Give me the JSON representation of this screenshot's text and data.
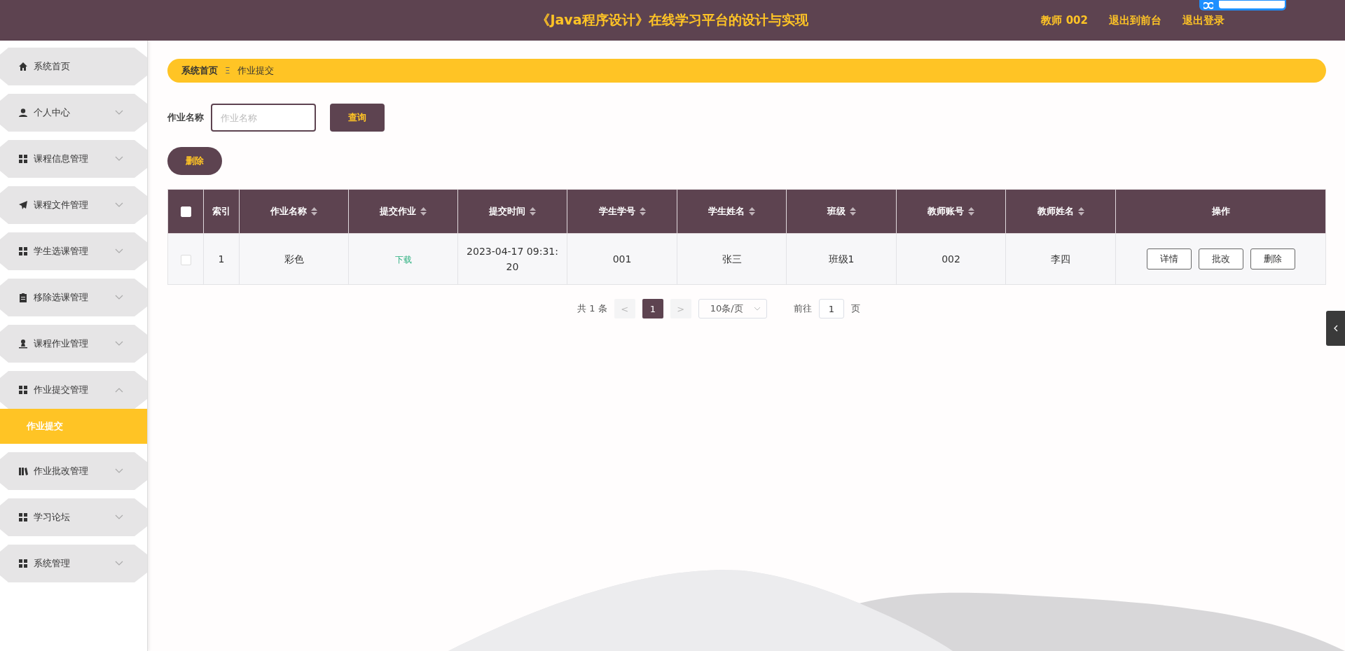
{
  "header": {
    "title": "《Java程序设计》在线学习平台的设计与实现",
    "links": [
      "教师 002",
      "退出到前台",
      "退出登录"
    ]
  },
  "sidebar": {
    "items": [
      {
        "label": "系统首页",
        "kind": "link"
      },
      {
        "label": "个人中心",
        "kind": "group",
        "expanded": false
      },
      {
        "label": "课程信息管理",
        "kind": "group",
        "expanded": false
      },
      {
        "label": "课程文件管理",
        "kind": "group",
        "expanded": false
      },
      {
        "label": "学生选课管理",
        "kind": "group",
        "expanded": false
      },
      {
        "label": "移除选课管理",
        "kind": "group",
        "expanded": false
      },
      {
        "label": "课程作业管理",
        "kind": "group",
        "expanded": false
      },
      {
        "label": "作业提交管理",
        "kind": "group",
        "expanded": true,
        "children": [
          {
            "label": "作业提交",
            "selected": true
          }
        ]
      },
      {
        "label": "作业批改管理",
        "kind": "group",
        "expanded": false
      },
      {
        "label": "学习论坛",
        "kind": "group",
        "expanded": false
      },
      {
        "label": "系统管理",
        "kind": "group",
        "expanded": false
      }
    ]
  },
  "breadcrumb": {
    "items": [
      "系统首页",
      "作业提交"
    ],
    "separator": "Ξ"
  },
  "search": {
    "label": "作业名称",
    "placeholder": "作业名称",
    "button": "查询"
  },
  "bulk_delete_button": "删除",
  "table": {
    "select_all": {
      "checked": false
    },
    "columns": [
      {
        "label": "索引",
        "sortable": false
      },
      {
        "label": "作业名称",
        "sortable": true
      },
      {
        "label": "提交作业",
        "sortable": true
      },
      {
        "label": "提交时间",
        "sortable": true
      },
      {
        "label": "学生学号",
        "sortable": true
      },
      {
        "label": "学生姓名",
        "sortable": true
      },
      {
        "label": "班级",
        "sortable": true
      },
      {
        "label": "教师账号",
        "sortable": true
      },
      {
        "label": "教师姓名",
        "sortable": true
      },
      {
        "label": "操作",
        "sortable": false
      }
    ],
    "rows": [
      {
        "checked": false,
        "cells": [
          {
            "kind": "text",
            "text": "1"
          },
          {
            "kind": "text",
            "text": "彩色"
          },
          {
            "kind": "link",
            "text": "下载"
          },
          {
            "kind": "text",
            "text": "2023-04-17 09:31:20"
          },
          {
            "kind": "text",
            "text": "001"
          },
          {
            "kind": "text",
            "text": "张三"
          },
          {
            "kind": "text",
            "text": "班级1"
          },
          {
            "kind": "text",
            "text": "002"
          },
          {
            "kind": "text",
            "text": "李四"
          }
        ],
        "actions": [
          "详情",
          "批改",
          "删除"
        ]
      }
    ]
  },
  "pagination": {
    "total": "共 1 条",
    "prev": "<",
    "pages": [
      {
        "label": "1",
        "selected": true
      }
    ],
    "next": ">",
    "page_size": "10条/页",
    "goto_label": "前往",
    "goto_value": "1",
    "goto_suffix": "页"
  }
}
